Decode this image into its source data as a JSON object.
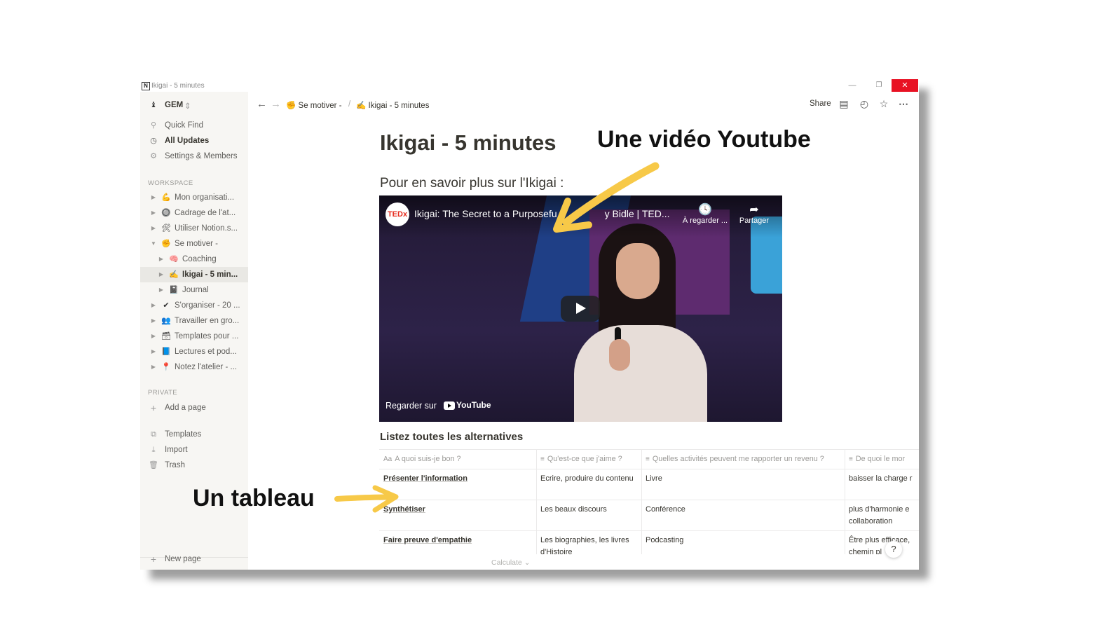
{
  "window": {
    "title": "Ikigai - 5 minutes",
    "app_logo": "N",
    "controls": {
      "minimize": "—",
      "maximize": "❐",
      "close": "✕"
    }
  },
  "sidebar": {
    "workspace_name": "GEM",
    "workspace_switch": "⇕",
    "top_items": [
      {
        "label": "Quick Find",
        "icon": "search-icon"
      },
      {
        "label": "All Updates",
        "icon": "clock-icon"
      },
      {
        "label": "Settings & Members",
        "icon": "gear-icon"
      }
    ],
    "workspace_label": "WORKSPACE",
    "workspace_items": [
      {
        "label": "Mon organisati...",
        "emoji": "💪"
      },
      {
        "label": "Cadrage de l'at...",
        "emoji": "🔘"
      },
      {
        "label": "Utiliser Notion.s...",
        "emoji": "🛠"
      },
      {
        "label": "Se motiver -",
        "emoji": "✊"
      },
      {
        "label": "Coaching",
        "emoji": "🧠"
      },
      {
        "label": "Ikigai - 5 min...",
        "emoji": "✍"
      },
      {
        "label": "Journal",
        "emoji": "📓"
      },
      {
        "label": "S'organiser - 20 ...",
        "emoji": "✔"
      },
      {
        "label": "Travailler en gro...",
        "emoji": "👥"
      },
      {
        "label": "Templates pour ...",
        "emoji": "🗃"
      },
      {
        "label": "Lectures et pod...",
        "emoji": "📘"
      },
      {
        "label": "Notez l'atelier - ...",
        "emoji": "📍"
      }
    ],
    "private_label": "PRIVATE",
    "add_page": "Add a page",
    "bottom_items": [
      {
        "label": "Templates",
        "icon": "templates-icon"
      },
      {
        "label": "Import",
        "icon": "import-icon"
      },
      {
        "label": "Trash",
        "icon": "trash-icon"
      }
    ],
    "new_page": "New page"
  },
  "topbar": {
    "breadcrumb": [
      {
        "label": "Se motiver -",
        "emoji": "✊"
      },
      {
        "label": "Ikigai - 5 minutes",
        "emoji": "✍"
      }
    ],
    "separator": "/",
    "share": "Share"
  },
  "page": {
    "title": "Ikigai - 5 minutes",
    "subheading": "Pour en savoir plus sur l'Ikigai :"
  },
  "video": {
    "channel_logo": "TEDx",
    "title": "Ikigai: The Secret to a Purposeful Life | Emy Bidle | TED...",
    "title_visible": "Ikigai: The Secret to a Purposefu",
    "title_tail": "y Bidle | TED...",
    "watch_later": "À regarder ...",
    "share": "Partager",
    "watch_on": "Regarder sur",
    "youtube": "YouTube"
  },
  "table": {
    "title": "Listez toutes les alternatives",
    "columns": [
      {
        "icon": "Aa",
        "label": "A quoi suis-je bon ?"
      },
      {
        "icon": "≡",
        "label": "Qu'est-ce que j'aime ?"
      },
      {
        "icon": "≡",
        "label": "Quelles activités peuvent me rapporter un revenu ?"
      },
      {
        "icon": "≡",
        "label": "De quoi le mor"
      }
    ],
    "rows": [
      [
        "Présenter l'information",
        "Ecrire, produire du contenu",
        "Livre",
        "baisser la charge r"
      ],
      [
        "Synthétiser",
        "Les beaux discours",
        "Conférence",
        "plus d'harmonie e collaboration"
      ],
      [
        "Faire preuve d'empathie",
        "Les biographies, les livres d'Histoire",
        "Podcasting",
        "Être plus efficace, chemin pl"
      ]
    ],
    "calculate": "Calculate ⌄"
  },
  "help": "?",
  "annotations": {
    "video": "Une vidéo Youtube",
    "table": "Un tableau"
  },
  "colors": {
    "arrow": "#f7c948",
    "close_button": "#e81123",
    "sidebar_bg": "#f7f6f3"
  }
}
